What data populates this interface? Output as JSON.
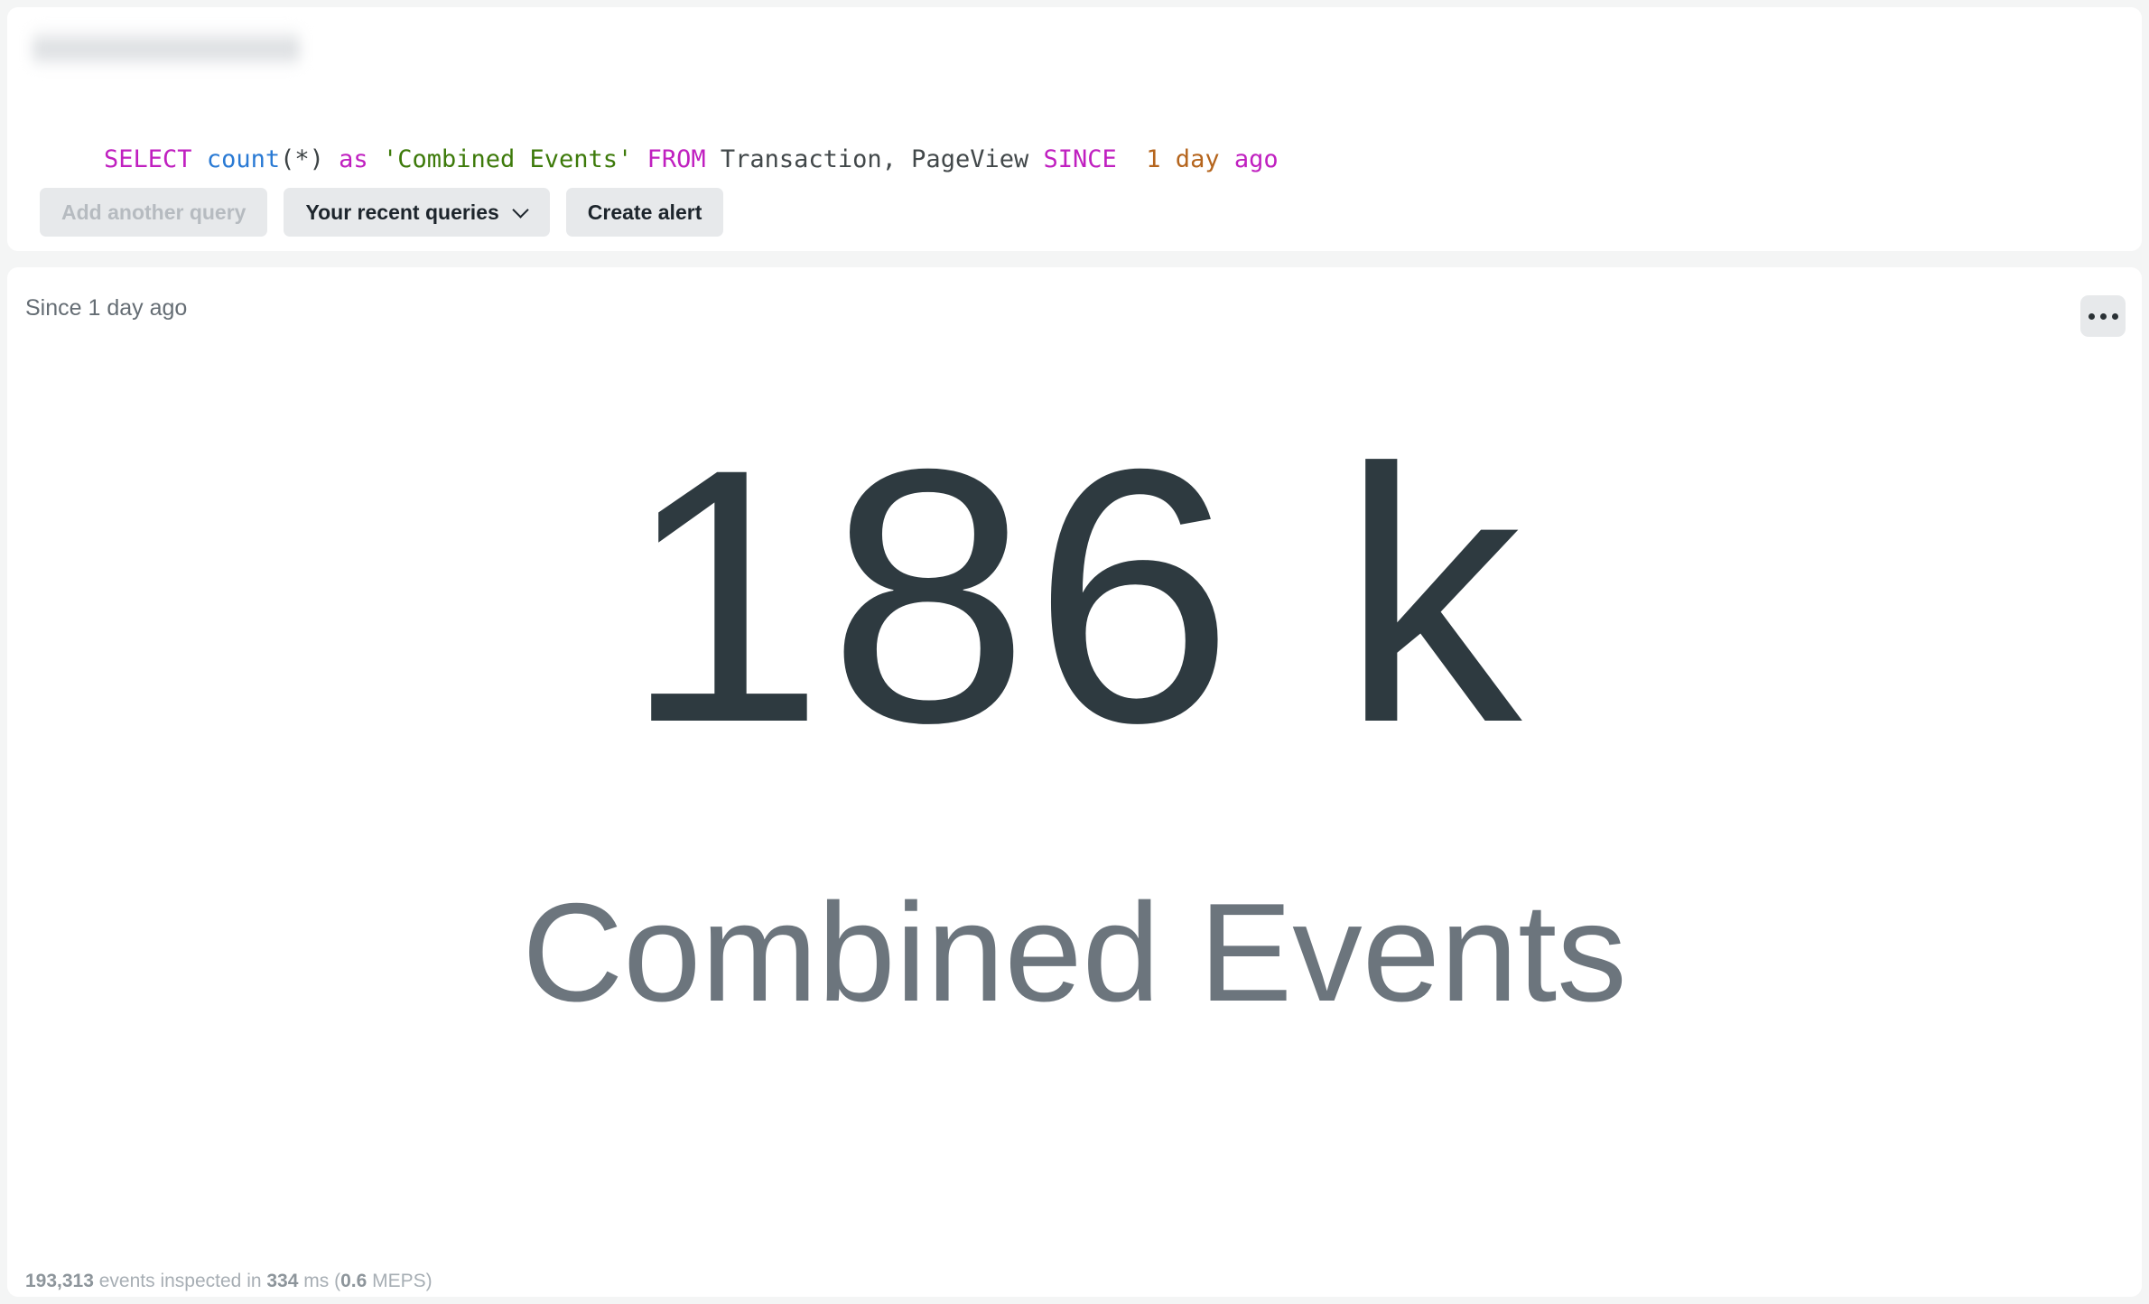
{
  "query_panel": {
    "breadcrumb_redacted": true,
    "query": {
      "full_text": "SELECT count(*) as 'Combined Events' FROM Transaction, PageView SINCE  1 day ago",
      "tokens": [
        {
          "text": "SELECT",
          "type": "keyword"
        },
        {
          "text": " ",
          "type": "plain"
        },
        {
          "text": "count",
          "type": "function"
        },
        {
          "text": "(*)",
          "type": "punct"
        },
        {
          "text": " ",
          "type": "plain"
        },
        {
          "text": "as",
          "type": "keyword"
        },
        {
          "text": " ",
          "type": "plain"
        },
        {
          "text": "'Combined Events'",
          "type": "string"
        },
        {
          "text": " ",
          "type": "plain"
        },
        {
          "text": "FROM",
          "type": "keyword"
        },
        {
          "text": " ",
          "type": "plain"
        },
        {
          "text": "Transaction, PageView",
          "type": "ident"
        },
        {
          "text": " ",
          "type": "plain"
        },
        {
          "text": "SINCE",
          "type": "keyword"
        },
        {
          "text": "  ",
          "type": "plain"
        },
        {
          "text": "1 day",
          "type": "number"
        },
        {
          "text": " ",
          "type": "plain"
        },
        {
          "text": "ago",
          "type": "keyword"
        }
      ]
    },
    "buttons": {
      "add_another_query": "Add another query",
      "recent_queries": "Your recent queries",
      "create_alert": "Create alert"
    }
  },
  "result_panel": {
    "time_range_label": "Since 1 day ago",
    "more_options_label": "...",
    "billboard": {
      "value": "186 k",
      "label": "Combined Events"
    },
    "footer": {
      "events_inspected": "193,313",
      "events_word": " events inspected in ",
      "duration": "334",
      "duration_unit": " ms (",
      "meps": "0.6",
      "meps_unit": " MEPS)"
    }
  },
  "colors": {
    "page_background": "#f4f5f5",
    "card_background": "#ffffff",
    "keyword": "#c020c0",
    "function": "#2a7ad4",
    "string": "#3d7a0a",
    "number": "#b5651d",
    "identifier": "#42484a",
    "billboard_value": "#2e3a40",
    "billboard_label": "#6c757d",
    "button_background": "#e7e9eb"
  }
}
